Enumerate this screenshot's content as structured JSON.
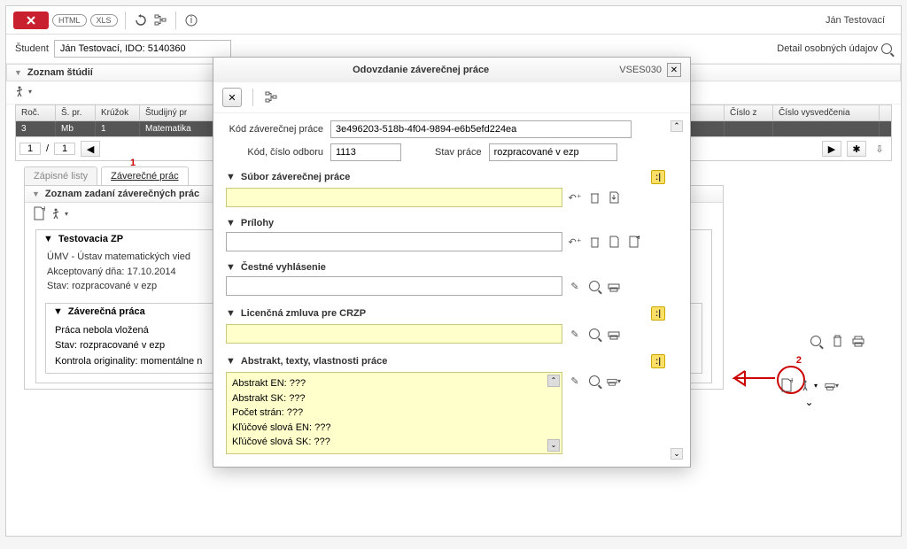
{
  "user": "Ján Testovací",
  "toolbar": {
    "html": "HTML",
    "xls": "XLS"
  },
  "student": {
    "label": "Študent",
    "value": "Ján Testovací, IDO: 5140360",
    "detail": "Detail osobných údajov"
  },
  "studies": {
    "header": "Zoznam štúdií",
    "cols": {
      "roc": "Roč.",
      "spr": "Š. pr.",
      "kruzok": "Krúžok",
      "program": "Študijný pr",
      "cisloz": "Číslo z",
      "vysved": "Číslo vysvedčenia"
    },
    "row": {
      "roc": "3",
      "spr": "Mb",
      "kruzok": "1",
      "program": "Matematika"
    },
    "page": "1",
    "pages": "1"
  },
  "tabs": {
    "zapisne": "Zápisné listy",
    "zaverecne": "Záverečné prác",
    "num": "1"
  },
  "assignments": {
    "header": "Zoznam zadaní záverečných prác",
    "card_title": "Testovacia ZP",
    "line1": "ÚMV - Ústav matematických vied",
    "line2": "Akceptovaný dňa: 17.10.2014",
    "line3": "Stav: rozpracované v ezp",
    "inner_title": "Záverečná práca",
    "inner1": "Práca nebola vložená",
    "inner2": "Stav: rozpracované v ezp",
    "inner3": "Kontrola originality: momentálne n"
  },
  "num2": "2",
  "modal": {
    "title": "Odovzdanie záverečnej práce",
    "code": "VSES030",
    "kod_label": "Kód záverečnej práce",
    "kod_value": "3e496203-518b-4f04-9894-e6b5efd224ea",
    "odbor_label": "Kód, číslo odboru",
    "odbor_value": "1113",
    "stav_label": "Stav práce",
    "stav_value": "rozpracované v ezp",
    "s1": "Súbor záverečnej práce",
    "s2": "Prílohy",
    "s3": "Čestné vyhlásenie",
    "s4": "Licenčná zmluva pre CRZP",
    "s5": "Abstrakt, texty, vlastnosti práce",
    "abs1": "Abstrakt EN: ???",
    "abs2": "Abstrakt SK: ???",
    "abs3": "Počet strán: ???",
    "abs4": "Kľúčové slová EN: ???",
    "abs5": "Kľúčové slová SK: ???"
  }
}
